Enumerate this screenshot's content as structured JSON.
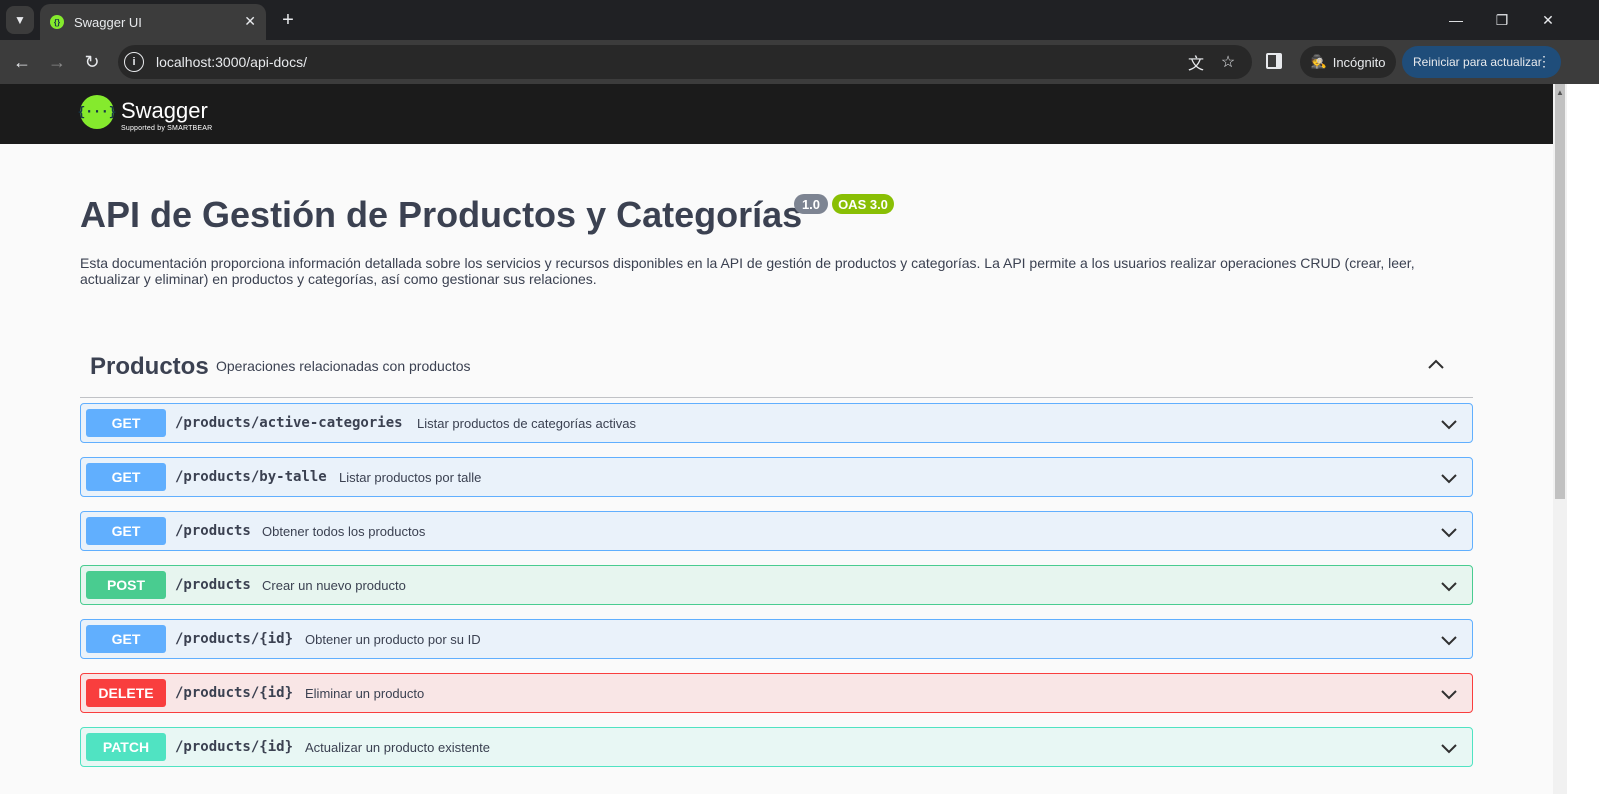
{
  "browser": {
    "tab_title": "Swagger UI",
    "tab_close": "✕",
    "new_tab": "+",
    "url": "localhost:3000/api-docs/",
    "incognito_label": "Incógnito",
    "update_label": "Reiniciar para actualizar"
  },
  "swagger": {
    "brand": "Swagger",
    "supported_by": "Supported by SMARTBEAR",
    "logo_mark": "{···}"
  },
  "info": {
    "title": "API de Gestión de Productos y Categorías",
    "version": "1.0",
    "oas": "OAS 3.0",
    "description": "Esta documentación proporciona información detallada sobre los servicios y recursos disponibles en la API de gestión de productos y categorías. La API permite a los usuarios realizar operaciones CRUD (crear, leer, actualizar y eliminar) en productos y categorías, así como gestionar sus relaciones."
  },
  "section": {
    "name": "Productos",
    "description": "Operaciones relacionadas con productos"
  },
  "operations": [
    {
      "method": "GET",
      "path": "/products/active-categories",
      "summary": "Listar productos de categorías activas"
    },
    {
      "method": "GET",
      "path": "/products/by-talle",
      "summary": "Listar productos por talle"
    },
    {
      "method": "GET",
      "path": "/products",
      "summary": "Obtener todos los productos"
    },
    {
      "method": "POST",
      "path": "/products",
      "summary": "Crear un nuevo producto"
    },
    {
      "method": "GET",
      "path": "/products/{id}",
      "summary": "Obtener un producto por su ID"
    },
    {
      "method": "DELETE",
      "path": "/products/{id}",
      "summary": "Eliminar un producto"
    },
    {
      "method": "PATCH",
      "path": "/products/{id}",
      "summary": "Actualizar un producto existente"
    }
  ],
  "colors": {
    "get": "#61affe",
    "post": "#49cc90",
    "delete": "#f93e3e",
    "patch": "#50e3c2",
    "swagger_green": "#85ea2d"
  }
}
